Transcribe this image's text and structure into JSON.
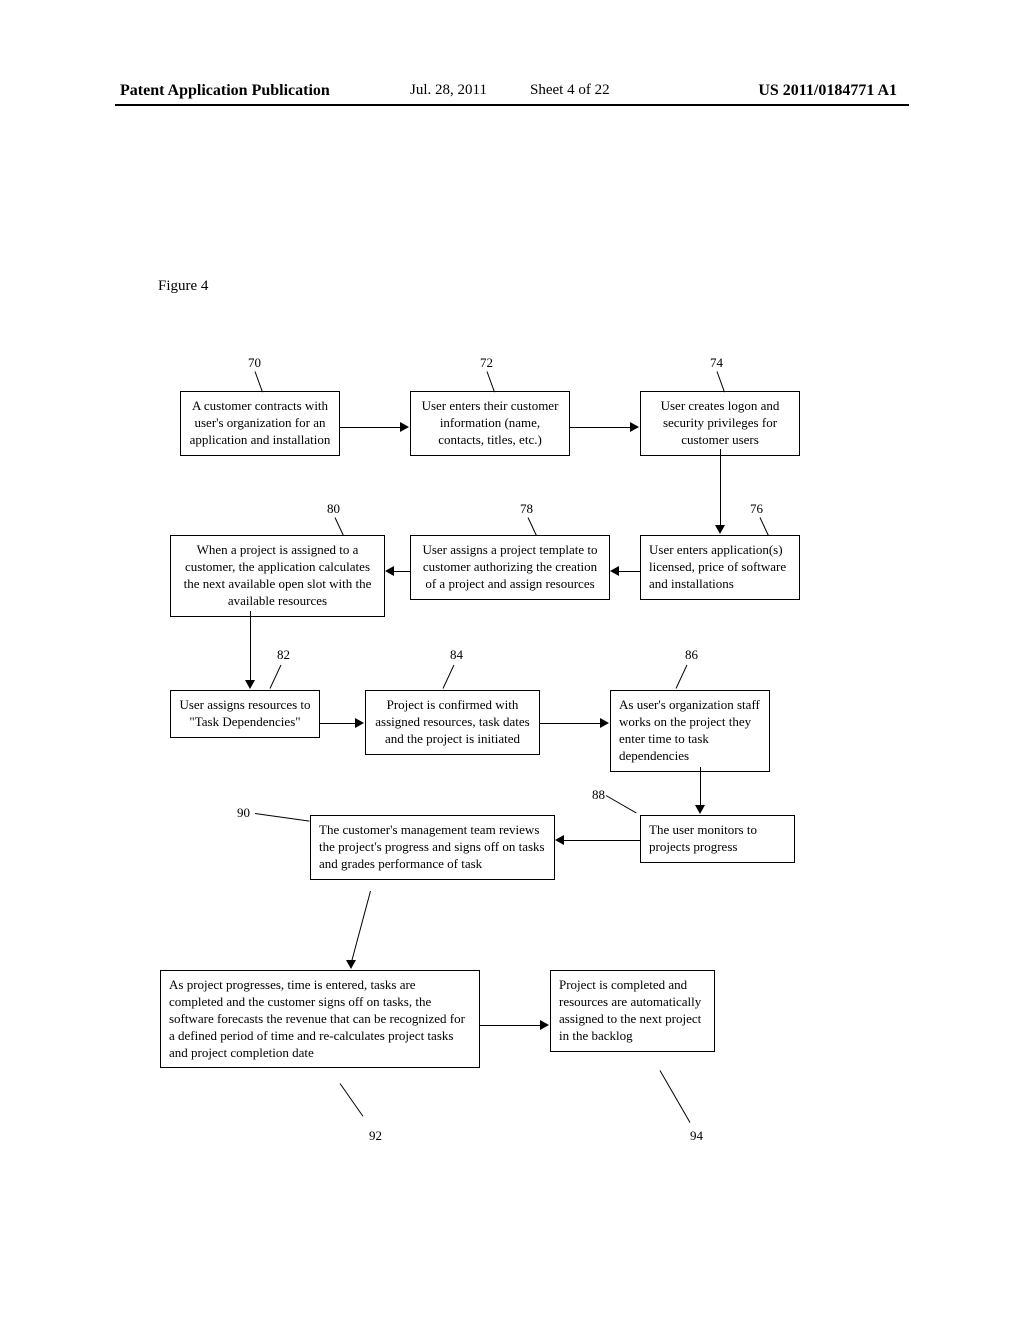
{
  "header": {
    "left": "Patent Application Publication",
    "date": "Jul. 28, 2011",
    "sheet": "Sheet 4 of 22",
    "right": "US 2011/0184771 A1"
  },
  "figure_label": "Figure 4",
  "boxes": {
    "b70": "A customer contracts with user's organization for an application and installation",
    "b72": "User enters their customer information (name, contacts, titles, etc.)",
    "b74": "User creates logon and security privileges for customer users",
    "b76": "User enters application(s) licensed, price of software and installations",
    "b78": "User assigns a project template to customer authorizing the creation of a project and assign resources",
    "b80": "When a project is assigned to a customer, the application calculates the next available open slot with the available resources",
    "b82": "User assigns resources to \"Task Dependencies\"",
    "b84": "Project is confirmed with assigned resources, task dates and the project is initiated",
    "b86": "As user's organization staff works on the project they enter time to task dependencies",
    "b88": "The user monitors to projects progress",
    "b90": "The customer's management team reviews the project's progress and signs off on tasks and grades performance of task",
    "b92": "As project progresses, time is entered, tasks are completed and the customer signs off on tasks, the software forecasts the revenue that can be recognized for a defined period of time and re-calculates project tasks and project completion date",
    "b94": "Project is completed and resources are automatically assigned to the next project in the backlog"
  },
  "refs": {
    "r70": "70",
    "r72": "72",
    "r74": "74",
    "r76": "76",
    "r78": "78",
    "r80": "80",
    "r82": "82",
    "r84": "84",
    "r86": "86",
    "r88": "88",
    "r90": "90",
    "r92": "92",
    "r94": "94"
  }
}
